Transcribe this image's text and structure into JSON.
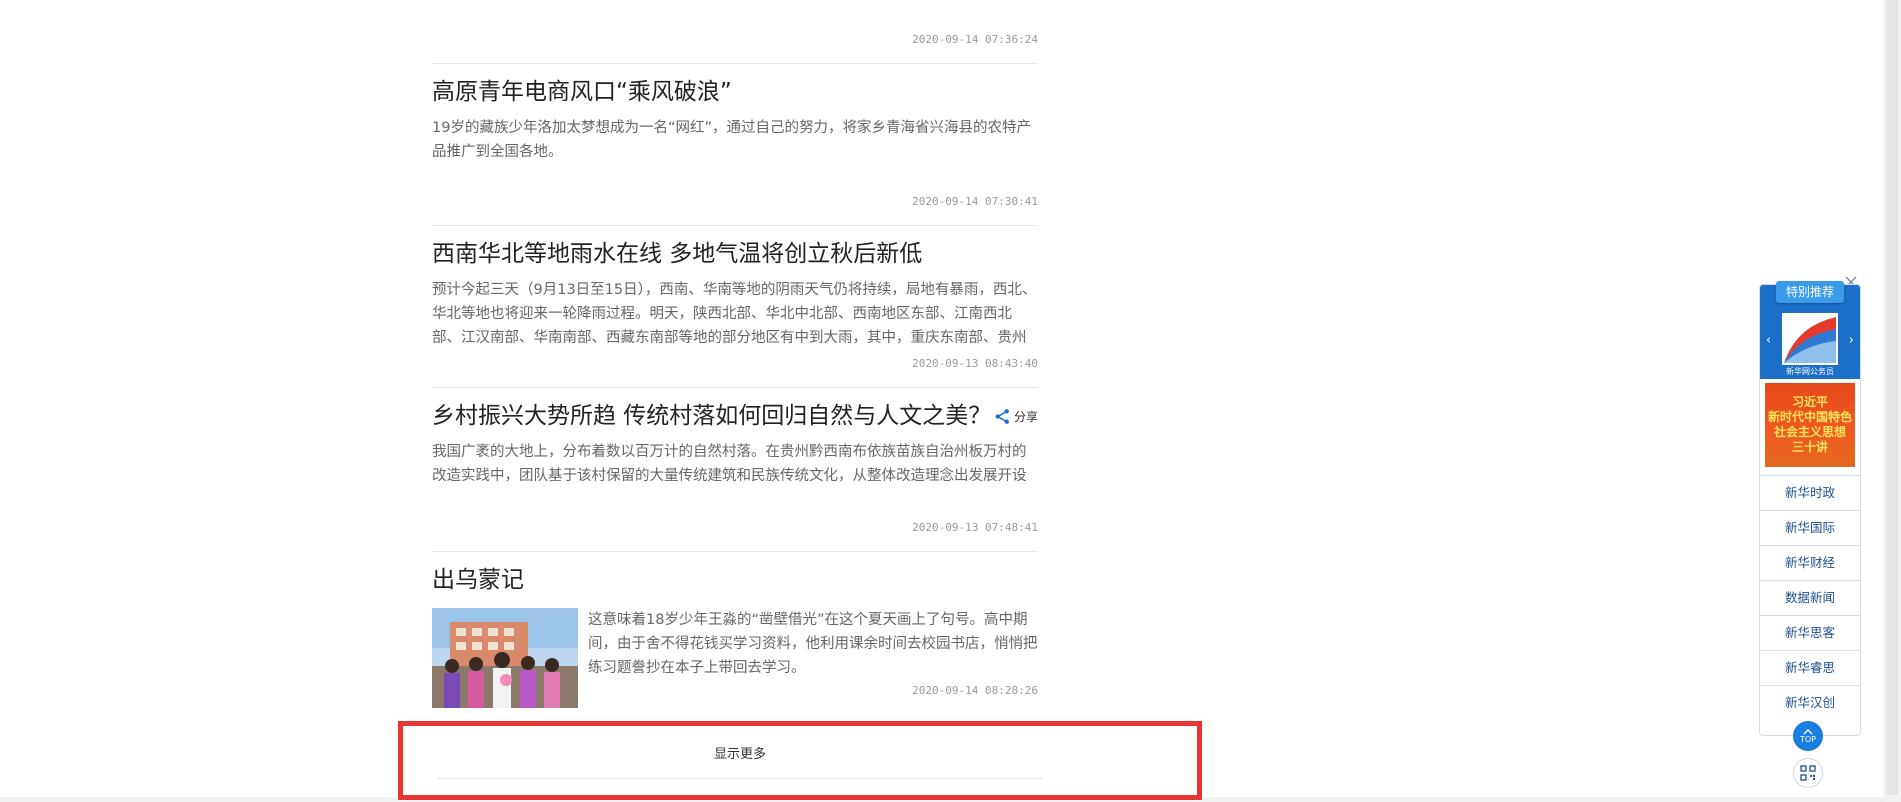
{
  "feed": {
    "top_item_time": "2020-09-14 07:36:24",
    "items": [
      {
        "title": "高原青年电商风口“乘风破浪”",
        "summary": "19岁的藏族少年洛加太梦想成为一名“网红”，通过自己的努力，将家乡青海省兴海县的农特产品推广到全国各地。",
        "time": "2020-09-14 07:30:41"
      },
      {
        "title": "西南华北等地雨水在线 多地气温将创立秋后新低",
        "summary": "预计今起三天（9月13日至15日），西南、华南等地的阴雨天气仍将持续，局地有暴雨，西北、华北等地也将迎来一轮降雨过程。明天，陕西北部、华北中北部、西南地区东部、江南西北部、江汉南部、华南南部、西藏东南部等地的部分地区有中到大雨，其中，重庆东南部、贵州中北部、湖南",
        "time": "2020-09-13 08:43:40"
      },
      {
        "title": "乡村振兴大势所趋 传统村落如何回归自然与人文之美？",
        "summary": "我国广袤的大地上，分布着数以百万计的自然村落。在贵州黔西南布依族苗族自治州板万村的改造实践中，团队基于该村保留的大量传统建筑和民族传统文化，从整体改造理念出发展开设计。",
        "time": "2020-09-13 07:48:41",
        "share_label": "分享"
      },
      {
        "title": "出乌蒙记",
        "summary": "这意味着18岁少年王淼的“凿壁借光”在这个夏天画上了句号。高中期间，由于舍不得花钱买学习资料，他利用课余时间去校园书店，悄悄把练习题誊抄在本子上带回去学习。",
        "time": "2020-09-14 08:28:26"
      }
    ],
    "more_label": "显示更多"
  },
  "side": {
    "rec_tag": "特别推荐",
    "rec_logo_text": "新华网公务员",
    "promo_lines": [
      "习近平",
      "新时代中国特色",
      "社会主义思想",
      "三十讲"
    ],
    "links": [
      "新华时政",
      "新华国际",
      "新华财经",
      "数据新闻",
      "新华思客",
      "新华睿思",
      "新华汉创"
    ],
    "top_label": "TOP"
  },
  "colors": {
    "accent_blue": "#1c6fc9",
    "highlight_red": "#ea3535",
    "link_blue": "#1d4f91"
  }
}
